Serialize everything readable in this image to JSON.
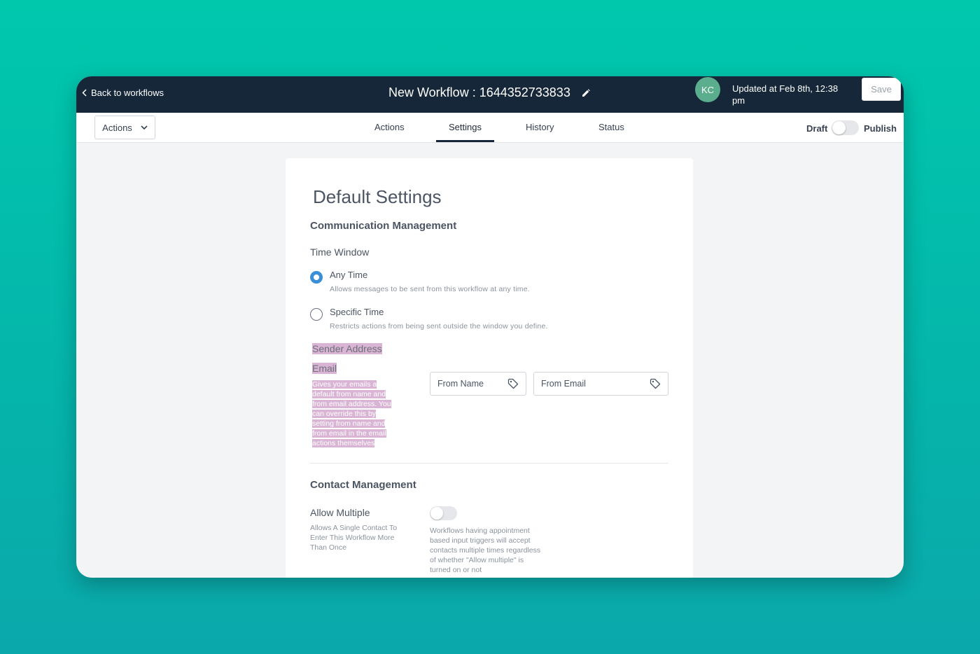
{
  "topbar": {
    "back_label": "Back to workflows",
    "title": "New Workflow : 1644352733833",
    "avatar_initials": "KC",
    "updated_text": "Updated at Feb 8th, 12:38 pm",
    "save_label": "Save"
  },
  "subbar": {
    "actions_label": "Actions",
    "tabs": [
      {
        "label": "Actions"
      },
      {
        "label": "Settings",
        "active": true
      },
      {
        "label": "History"
      },
      {
        "label": "Status"
      }
    ],
    "draft_label": "Draft",
    "publish_label": "Publish",
    "publish_on": false
  },
  "settings": {
    "title": "Default Settings",
    "communication": {
      "title": "Communication Management",
      "time_window_label": "Time Window",
      "options": [
        {
          "label": "Any Time",
          "desc": "Allows messages to be sent from this workflow at any time.",
          "selected": true
        },
        {
          "label": "Specific Time",
          "desc": "Restricts actions from being sent outside the window you define.",
          "selected": false
        }
      ],
      "sender_address_label": "Sender Address",
      "email_label": "Email",
      "email_desc_lines": [
        "Gives your emails a",
        "default from name and",
        "from email address. You",
        "can override this by",
        "setting from name and",
        "from email in the email",
        "actions themselves"
      ],
      "from_name_placeholder": "From Name",
      "from_email_placeholder": "From Email"
    },
    "contact": {
      "title": "Contact Management",
      "allow_multiple_label": "Allow Multiple",
      "allow_multiple_desc": "Allows A Single Contact To Enter This Workflow More Than Once",
      "allow_multiple_on": false,
      "allow_multiple_note": "Workflows having appointment based input triggers will accept contacts multiple times regardless of whether \"Allow multiple\" is turned on or not"
    }
  },
  "colors": {
    "background": "#00c8ad",
    "topbar": "#152738",
    "radio_selected": "#3b8fd6",
    "highlight": "#d9b4d5",
    "avatar": "#5aae8e"
  }
}
